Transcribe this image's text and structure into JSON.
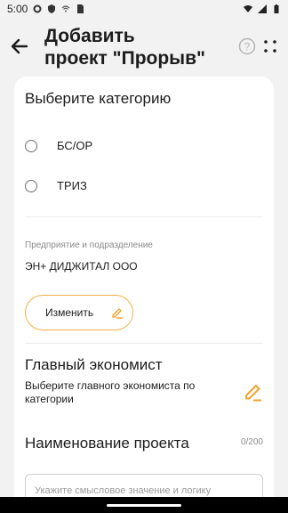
{
  "status_bar": {
    "time": "5:00",
    "icons": [
      "gear-icon",
      "shield-icon",
      "wifi-small-icon",
      "sim-icon",
      "wifi-icon",
      "signal-icon",
      "battery-icon"
    ]
  },
  "header": {
    "title_line1": "Добавить",
    "title_line2": "проект \"Прорыв\"",
    "icons": [
      "back-arrow-icon",
      "help-icon",
      "dots-menu-icon"
    ]
  },
  "category": {
    "title": "Выберите категорию",
    "options": [
      {
        "label": "БС/ОР",
        "selected": false
      },
      {
        "label": "ТРИЗ",
        "selected": false
      }
    ]
  },
  "enterprise": {
    "label": "Предприятие и подразделение",
    "value": "ЭН+ ДИДЖИТАЛ ООО",
    "change_button": "Изменить"
  },
  "economist": {
    "title": "Главный экономист",
    "description": "Выберите главного экономиста по категории"
  },
  "project_name": {
    "title": "Наименование проекта",
    "counter": "0/200",
    "placeholder": "Укажите смысловое значение и логику"
  },
  "colors": {
    "accent": "#f3b24a",
    "pencil": "#f0a32c",
    "background": "#f2f2f2",
    "card": "#ffffff"
  }
}
